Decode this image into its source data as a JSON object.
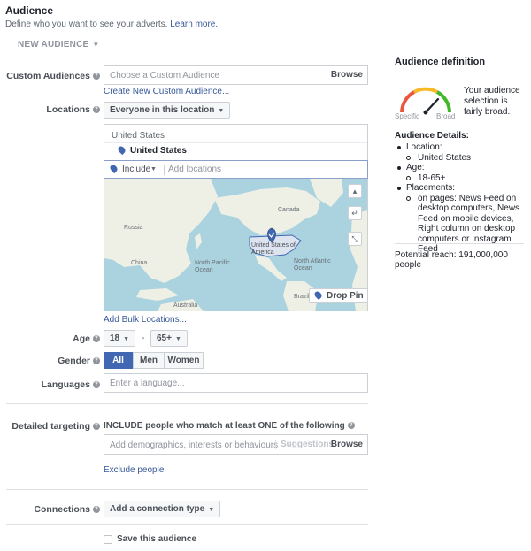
{
  "header": {
    "title": "Audience",
    "subtitle": "Define who you want to see your adverts.",
    "learn_more": "Learn more."
  },
  "new_audience": "NEW AUDIENCE",
  "custom_audiences": {
    "label": "Custom Audiences",
    "placeholder": "Choose a Custom Audience",
    "browse": "Browse",
    "create_link": "Create New Custom Audience..."
  },
  "locations": {
    "label": "Locations",
    "dropdown": "Everyone in this location",
    "group": "United States",
    "selected": "United States",
    "include": "Include",
    "placeholder": "Add locations",
    "drop_pin": "Drop Pin",
    "bulk_link": "Add Bulk Locations...",
    "map_labels": {
      "russia": "Russia",
      "china": "China",
      "north_pacific": "North Pacific Ocean",
      "canada": "Canada",
      "usa": "United States of America",
      "north_atlantic": "North Atlantic Ocean",
      "australia": "Australia",
      "brazil": "Brazil"
    }
  },
  "age": {
    "label": "Age",
    "min": "18",
    "dash": "-",
    "max": "65+"
  },
  "gender": {
    "label": "Gender",
    "options": [
      "All",
      "Men",
      "Women"
    ],
    "selected": "All"
  },
  "languages": {
    "label": "Languages",
    "placeholder": "Enter a language..."
  },
  "detailed_targeting": {
    "label": "Detailed targeting",
    "description": "INCLUDE people who match at least ONE of the following",
    "placeholder": "Add demographics, interests or behaviours",
    "suggestions": "Suggestions",
    "browse": "Browse",
    "exclude_link": "Exclude people"
  },
  "connections": {
    "label": "Connections",
    "dropdown": "Add a connection type"
  },
  "save_audience": "Save this audience",
  "audience_definition": {
    "title": "Audience definition",
    "gauge_text": "Your audience selection is fairly broad.",
    "gauge_left": "Specific",
    "gauge_right": "Broad",
    "details_title": "Audience Details:",
    "location_label": "Location:",
    "location_value": "United States",
    "age_label": "Age:",
    "age_value": "18-65+",
    "placements_label": "Placements:",
    "placements_value": "on pages: News Feed on desktop computers, News Feed on mobile devices, Right column on desktop computers or Instagram Feed",
    "potential_reach": "Potential reach: 191,000,000 people"
  },
  "colors": {
    "accent": "#4267b2",
    "link": "#365899",
    "gauge_red": "#e9573f",
    "gauge_yellow": "#f7b928",
    "gauge_green": "#42b72a"
  }
}
